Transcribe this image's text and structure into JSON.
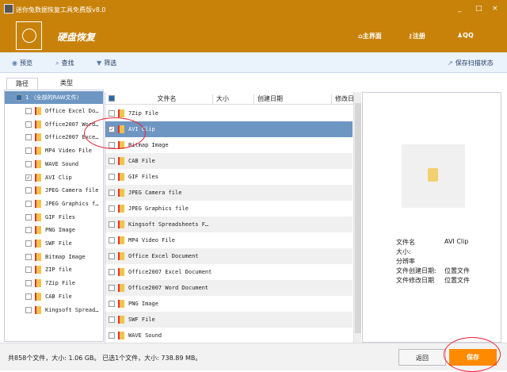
{
  "window": {
    "title": "迷你兔数据恢复工具免费版v8.0",
    "minimize": "_",
    "maximize": "□",
    "close": "×"
  },
  "header": {
    "module": "硬盘恢复",
    "nav": [
      {
        "label": "主界面",
        "icon": "home-icon"
      },
      {
        "label": "注册",
        "icon": "key-icon"
      },
      {
        "label": "QQ",
        "icon": "qq-icon"
      }
    ]
  },
  "toolbar": {
    "preview": "预览",
    "search": "查找",
    "filter": "筛选",
    "save_state": "保存扫描状态"
  },
  "tabs": [
    {
      "label": "路径",
      "active": true
    },
    {
      "label": "类型",
      "active": false
    }
  ],
  "tree": {
    "root": "1 （全部的RAW文件）",
    "items": [
      {
        "label": "Office Excel Do…",
        "checked": false
      },
      {
        "label": "Office2007 Word…",
        "checked": false
      },
      {
        "label": "Office2007 Exce…",
        "checked": false
      },
      {
        "label": "MP4 Video File",
        "checked": false
      },
      {
        "label": "WAVE Sound",
        "checked": false
      },
      {
        "label": "AVI Clip",
        "checked": true
      },
      {
        "label": "JPEG Camera file",
        "checked": false
      },
      {
        "label": "JPEG Graphics f…",
        "checked": false
      },
      {
        "label": "GIF Files",
        "checked": false
      },
      {
        "label": "PNG Image",
        "checked": false
      },
      {
        "label": "SWF File",
        "checked": false
      },
      {
        "label": "Bitmap Image",
        "checked": false
      },
      {
        "label": "ZIP file",
        "checked": false
      },
      {
        "label": "7Zip File",
        "checked": false
      },
      {
        "label": "CAB File",
        "checked": false
      },
      {
        "label": "Kingsoft Spread…",
        "checked": false
      }
    ]
  },
  "list": {
    "columns": [
      "文件名",
      "大小",
      "创建日期",
      "修改日"
    ],
    "rows": [
      {
        "name": "7Zip File",
        "checked": false
      },
      {
        "name": "AVI Clip",
        "checked": true,
        "selected": true
      },
      {
        "name": "Bitmap Image",
        "checked": false
      },
      {
        "name": "CAB File",
        "checked": false
      },
      {
        "name": "GIF Files",
        "checked": false
      },
      {
        "name": "JPEG Camera file",
        "checked": false
      },
      {
        "name": "JPEG Graphics file",
        "checked": false
      },
      {
        "name": "Kingsoft Spreadsheets F…",
        "checked": false
      },
      {
        "name": "MP4 Video File",
        "checked": false
      },
      {
        "name": "Office Excel Document",
        "checked": false
      },
      {
        "name": "Office2007 Excel Document",
        "checked": false
      },
      {
        "name": "Office2007 Word Document",
        "checked": false
      },
      {
        "name": "PNG Image",
        "checked": false
      },
      {
        "name": "SWF File",
        "checked": false
      },
      {
        "name": "WAVE Sound",
        "checked": false
      }
    ]
  },
  "preview": {
    "labels": [
      "文件名",
      "大小:",
      "分辨率",
      "文件创建日期:",
      "文件修改日期"
    ],
    "values": [
      "AVI Clip",
      "",
      "",
      "位置文件",
      "位置文件"
    ]
  },
  "status": {
    "text": "共858个文件，大小: 1.06 GB。 已选1个文件，大小: 738.89 MB。",
    "back": "返回",
    "save": "保存"
  },
  "colors": {
    "brand": "#c8820a",
    "selection": "#6e96c2",
    "save_button": "#ff8a00"
  }
}
